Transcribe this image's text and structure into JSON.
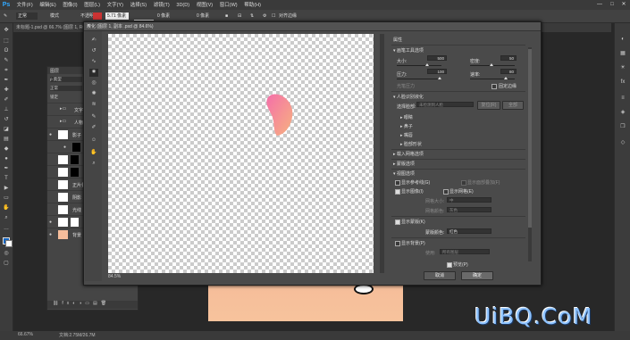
{
  "app": {
    "logo": "Ps",
    "menu": [
      "文件(F)",
      "编辑(E)",
      "图像(I)",
      "图层(L)",
      "文字(Y)",
      "选择(S)",
      "滤镜(T)",
      "3D(D)",
      "视图(V)",
      "窗口(W)",
      "帮助(H)"
    ],
    "window_controls": [
      "—",
      "□",
      "✕"
    ]
  },
  "options_bar": {
    "mode_label": "模式",
    "mode_value": "正常",
    "opacity_label": "不透明度",
    "opacity_value": "100%",
    "size_value": "5.71 像素",
    "dist_value": "0 像素",
    "align_label": "对齐边缘"
  },
  "document": {
    "tab_title": "未标题-1.psd @ 66.7% (图层 1, RGB/8#) *"
  },
  "layers_panel": {
    "title": "图层",
    "filter_label": "ρ 类型",
    "blend_mode": "正常",
    "opacity_label": "不透明度",
    "lock_label": "锁定",
    "fill_label": "填充",
    "layers": [
      {
        "name": "文字",
        "eye": ""
      },
      {
        "name": "人物",
        "eye": ""
      },
      {
        "name": "影子",
        "eye": "●"
      },
      {
        "name": "曲线",
        "eye": "●"
      },
      {
        "name": "蓝色",
        "eye": ""
      },
      {
        "name": "红色",
        "eye": ""
      },
      {
        "name": "正片叠底",
        "eye": ""
      },
      {
        "name": "阴影",
        "eye": ""
      },
      {
        "name": "光线",
        "eye": ""
      },
      {
        "name": "颜色",
        "eye": "●"
      },
      {
        "name": "背景",
        "eye": "●"
      }
    ]
  },
  "dialog": {
    "title": "液化 (图层 1, 副本 .psd @ 84.6%)",
    "zoom": "84.5%",
    "properties": {
      "header": "属性",
      "brush_tools_section": "画笔工具选项",
      "size_label": "大小:",
      "size_value": "500",
      "density_label": "密度:",
      "density_value": "50",
      "pressure_label": "压力:",
      "pressure_value": "100",
      "rate_label": "速率:",
      "rate_value": "80",
      "stylus_label": "光笔压力",
      "pin_edges_label": "固定边缘",
      "face_section": "人脸识别液化",
      "select_face_label": "选择脸部:",
      "select_face_value": "未检测到人脸",
      "reset_label": "复位(R)",
      "all_label": "全部",
      "face_items": [
        "眼睛",
        "鼻子",
        "嘴唇",
        "脸部形状"
      ],
      "load_mesh": "载入网格选项",
      "mask_options": "蒙版选项",
      "view_options": "视图选项",
      "show_guides": "显示参考线(G)",
      "show_face_overlay": "显示面部叠加(F)",
      "show_image": "显示图像(I)",
      "show_mesh": "显示网格(E)",
      "mesh_size_label": "网格大小:",
      "mesh_size_value": "中",
      "mesh_color_label": "网格颜色:",
      "mesh_color_value": "灰色",
      "show_mask": "显示蒙版(K)",
      "mask_color_label": "蒙版颜色:",
      "mask_color_value": "红色",
      "show_backdrop": "显示背景(P)",
      "use_label": "使用:",
      "use_value": "所有图层",
      "preview_label": "预览(P)",
      "cancel": "取消",
      "ok": "确定"
    }
  },
  "status": {
    "zoom": "66.67%",
    "doc": "文档:2.75M/26.7M"
  },
  "watermark": "UiBQ.CoM",
  "colors": {
    "accent": "#31a8ff",
    "petal_top": "#f46fa9",
    "petal_bottom": "#f7b27f",
    "peach": "#f5bd9a"
  }
}
